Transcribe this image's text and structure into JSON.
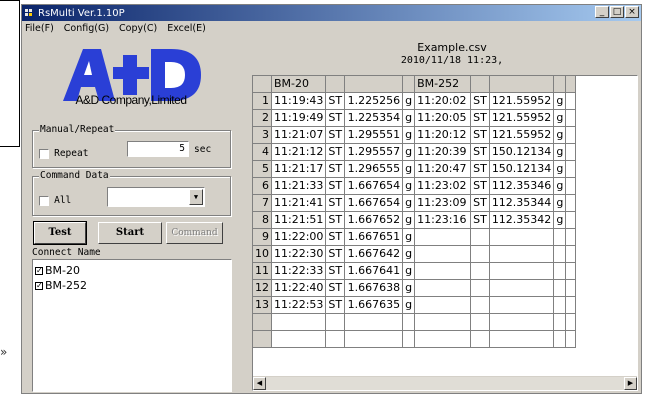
{
  "window": {
    "title": "RsMulti Ver.1.10P"
  },
  "menu": [
    "File(F)",
    "Config(G)",
    "Copy(C)",
    "Excel(E)"
  ],
  "brand": {
    "logo_text": "A&D",
    "company": "A&D Company,Limited"
  },
  "manual_repeat": {
    "title": "Manual/Repeat",
    "repeat_label": "Repeat",
    "repeat_checked": false,
    "interval_value": "5",
    "unit": "sec"
  },
  "command_data": {
    "title": "Command Data",
    "all_label": "All",
    "all_checked": false,
    "selected": ""
  },
  "buttons": {
    "test": "Test",
    "start": "Start",
    "command": "Command"
  },
  "connect": {
    "title": "Connect Name",
    "items": [
      {
        "label": "BM-20",
        "checked": true
      },
      {
        "label": "BM-252",
        "checked": true
      }
    ]
  },
  "csv": {
    "filename": "Example.csv",
    "datetime": "2010/11/18 11:23,"
  },
  "grid": {
    "headers": [
      "BM-20",
      "BM-252"
    ],
    "rows": [
      {
        "n": "1",
        "t1": "11:19:43",
        "s1": "ST",
        "v1": "1.225256",
        "u1": "g",
        "t2": "11:20:02",
        "s2": "ST",
        "v2": "121.55952",
        "u2": "g"
      },
      {
        "n": "2",
        "t1": "11:19:49",
        "s1": "ST",
        "v1": "1.225354",
        "u1": "g",
        "t2": "11:20:05",
        "s2": "ST",
        "v2": "121.55952",
        "u2": "g"
      },
      {
        "n": "3",
        "t1": "11:21:07",
        "s1": "ST",
        "v1": "1.295551",
        "u1": "g",
        "t2": "11:20:12",
        "s2": "ST",
        "v2": "121.55952",
        "u2": "g"
      },
      {
        "n": "4",
        "t1": "11:21:12",
        "s1": "ST",
        "v1": "1.295557",
        "u1": "g",
        "t2": "11:20:39",
        "s2": "ST",
        "v2": "150.12134",
        "u2": "g"
      },
      {
        "n": "5",
        "t1": "11:21:17",
        "s1": "ST",
        "v1": "1.296555",
        "u1": "g",
        "t2": "11:20:47",
        "s2": "ST",
        "v2": "150.12134",
        "u2": "g"
      },
      {
        "n": "6",
        "t1": "11:21:33",
        "s1": "ST",
        "v1": "1.667654",
        "u1": "g",
        "t2": "11:23:02",
        "s2": "ST",
        "v2": "112.35346",
        "u2": "g"
      },
      {
        "n": "7",
        "t1": "11:21:41",
        "s1": "ST",
        "v1": "1.667654",
        "u1": "g",
        "t2": "11:23:09",
        "s2": "ST",
        "v2": "112.35344",
        "u2": "g"
      },
      {
        "n": "8",
        "t1": "11:21:51",
        "s1": "ST",
        "v1": "1.667652",
        "u1": "g",
        "t2": "11:23:16",
        "s2": "ST",
        "v2": "112.35342",
        "u2": "g"
      },
      {
        "n": "9",
        "t1": "11:22:00",
        "s1": "ST",
        "v1": "1.667651",
        "u1": "g",
        "t2": "",
        "s2": "",
        "v2": "",
        "u2": ""
      },
      {
        "n": "10",
        "t1": "11:22:30",
        "s1": "ST",
        "v1": "1.667642",
        "u1": "g",
        "t2": "",
        "s2": "",
        "v2": "",
        "u2": ""
      },
      {
        "n": "11",
        "t1": "11:22:33",
        "s1": "ST",
        "v1": "1.667641",
        "u1": "g",
        "t2": "",
        "s2": "",
        "v2": "",
        "u2": ""
      },
      {
        "n": "12",
        "t1": "11:22:40",
        "s1": "ST",
        "v1": "1.667638",
        "u1": "g",
        "t2": "",
        "s2": "",
        "v2": "",
        "u2": ""
      },
      {
        "n": "13",
        "t1": "11:22:53",
        "s1": "ST",
        "v1": "1.667635",
        "u1": "g",
        "t2": "",
        "s2": "",
        "v2": "",
        "u2": ""
      }
    ]
  },
  "colors": {
    "title_start": "#0a246a",
    "title_end": "#a6caf0",
    "logo_blue": "#2a3fd6",
    "face": "#d4d0c8"
  },
  "icons": {
    "app": "app-icon",
    "minimize": "minimize-icon",
    "maximize": "maximize-icon",
    "close": "close-icon",
    "dropdown": "chevron-down-icon",
    "scroll_left": "scroll-left-icon",
    "scroll_right": "scroll-right-icon",
    "side": "double-chevron-right-icon"
  }
}
